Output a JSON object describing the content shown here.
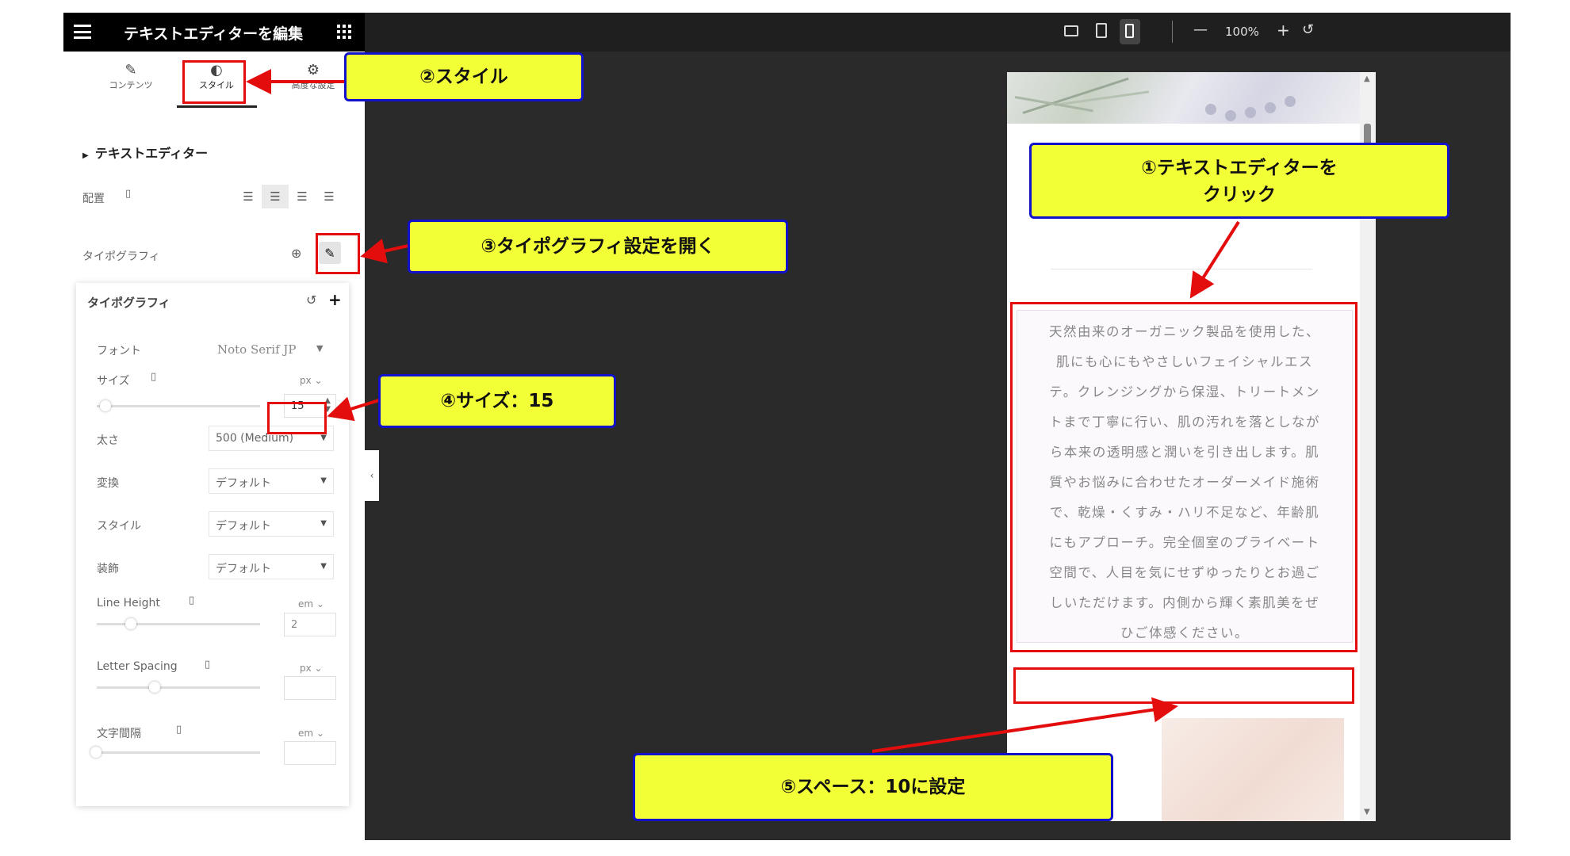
{
  "topbar": {
    "title": "テキストエディターを編集",
    "zoom": "100%",
    "zoom_minus": "—",
    "zoom_plus": "+",
    "reset": "↺"
  },
  "tabs": [
    {
      "label": "コンテンツ",
      "icon": "pencil-icon"
    },
    {
      "label": "スタイル",
      "icon": "contrast-icon"
    },
    {
      "label": "高度な設定",
      "icon": "gear-icon"
    }
  ],
  "panel": {
    "section_title": "テキストエディター",
    "align_label": "配置",
    "typography_label": "タイポグラフィ"
  },
  "typography": {
    "title": "タイポグラフィ",
    "font_label": "フォント",
    "font_value": "Noto Serif JP",
    "size_label": "サイズ",
    "size_unit": "px",
    "size_value": "15",
    "weight_label": "太さ",
    "weight_value": "500 (Medium)",
    "transform_label": "変換",
    "transform_value": "デフォルト",
    "style_label": "スタイル",
    "style_value": "デフォルト",
    "decoration_label": "装飾",
    "decoration_value": "デフォルト",
    "line_height_label": "Line Height",
    "line_height_unit": "em",
    "line_height_value": "2",
    "letter_spacing_label": "Letter Spacing",
    "letter_spacing_unit": "px",
    "word_spacing_label": "文字間隔",
    "word_spacing_unit": "em"
  },
  "preview": {
    "lines": [
      "天然由来のオーガニック製品を使用した、",
      "肌にも心にもやさしいフェイシャルエス",
      "テ。クレンジングから保湿、トリートメン",
      "トまで丁寧に行い、肌の汚れを落としなが",
      "ら本来の透明感と潤いを引き出します。肌",
      "質やお悩みに合わせたオーダーメイド施術",
      "で、乾燥・くすみ・ハリ不足など、年齢肌",
      "にもアプローチ。完全個室のプライベート",
      "空間で、人目を気にせずゆったりとお過ご",
      "しいただけます。内側から輝く素肌美をぜ",
      "ひご体感ください。"
    ]
  },
  "callouts": {
    "c1_line1": "①テキストエディターを",
    "c1_line2": "クリック",
    "c2": "②スタイル",
    "c3": "③タイポグラフィ設定を開く",
    "c4": "④サイズ：15",
    "c5": "⑤スペース：10に設定"
  },
  "colors": {
    "callout_bg": "#f3ff36",
    "callout_border": "#1212cc",
    "highlight_red": "#e40d0d",
    "topbar_bg": "#1f1f1f",
    "canvas_bg": "#2a2a2a"
  }
}
